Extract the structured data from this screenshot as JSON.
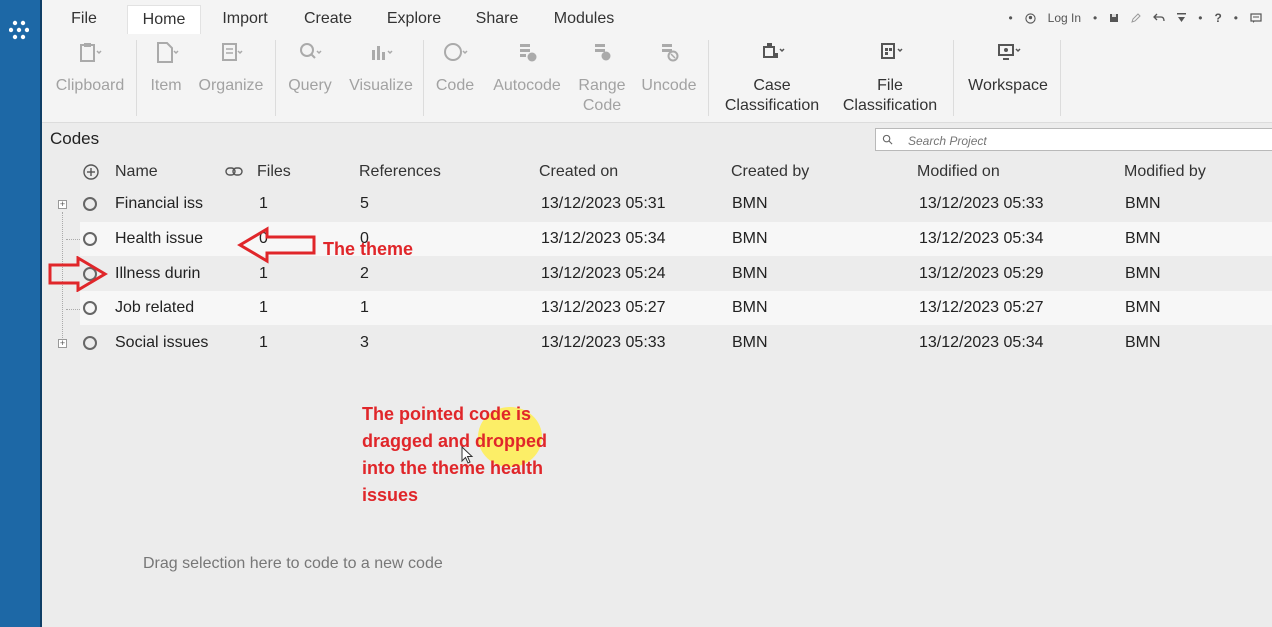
{
  "app": {
    "menu_icon": "app-grid-icon"
  },
  "tabs": [
    {
      "label": "File"
    },
    {
      "label": "Home"
    },
    {
      "label": "Import"
    },
    {
      "label": "Create"
    },
    {
      "label": "Explore"
    },
    {
      "label": "Share"
    },
    {
      "label": "Modules"
    }
  ],
  "active_tab": "Home",
  "quick_actions": {
    "login_label": "Log In"
  },
  "ribbon": {
    "clipboard": "Clipboard",
    "item": "Item",
    "organize": "Organize",
    "query": "Query",
    "visualize": "Visualize",
    "code": "Code",
    "autocode": "Autocode",
    "range_code_1": "Range",
    "range_code_2": "Code",
    "uncode": "Uncode",
    "case_class_1": "Case",
    "case_class_2": "Classification",
    "file_class_1": "File",
    "file_class_2": "Classification",
    "workspace": "Workspace"
  },
  "panel": {
    "title": "Codes",
    "search_placeholder": "Search Project"
  },
  "table": {
    "columns": {
      "name": "Name",
      "files": "Files",
      "references": "References",
      "created_on": "Created on",
      "created_by": "Created by",
      "modified_on": "Modified on",
      "modified_by": "Modified by"
    },
    "rows": [
      {
        "name": "Financial iss",
        "files": "1",
        "references": "5",
        "created_on": "13/12/2023 05:31",
        "created_by": "BMN",
        "modified_on": "13/12/2023 05:33",
        "modified_by": "BMN"
      },
      {
        "name": "Health issue",
        "files": "0",
        "references": "0",
        "created_on": "13/12/2023 05:34",
        "created_by": "BMN",
        "modified_on": "13/12/2023 05:34",
        "modified_by": "BMN"
      },
      {
        "name": "Illness durin",
        "files": "1",
        "references": "2",
        "created_on": "13/12/2023 05:24",
        "created_by": "BMN",
        "modified_on": "13/12/2023 05:29",
        "modified_by": "BMN"
      },
      {
        "name": "Job related",
        "files": "1",
        "references": "1",
        "created_on": "13/12/2023 05:27",
        "created_by": "BMN",
        "modified_on": "13/12/2023 05:27",
        "modified_by": "BMN"
      },
      {
        "name": "Social issues",
        "files": "1",
        "references": "3",
        "created_on": "13/12/2023 05:33",
        "created_by": "BMN",
        "modified_on": "13/12/2023 05:34",
        "modified_by": "BMN"
      }
    ]
  },
  "annotations": {
    "theme_label": "The theme",
    "note_line1": "The pointed code is",
    "note_line2": "dragged and dropped",
    "note_line3": "into the theme health",
    "note_line4": "issues",
    "arrow_color": "#e0262a"
  },
  "drop_hint": "Drag selection here to code to a new code"
}
